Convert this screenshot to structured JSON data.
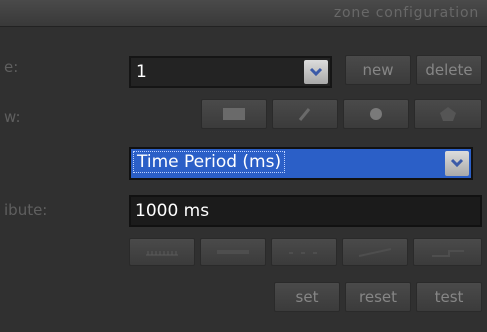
{
  "header": {
    "title": "zone configuration"
  },
  "rows": {
    "zone_label": "e:",
    "draw_label": "w:",
    "attribute_label": "ibute:"
  },
  "zone": {
    "selected": "1",
    "new_label": "new",
    "delete_label": "delete"
  },
  "draw_tools": [
    {
      "icon": "rectangle-icon"
    },
    {
      "icon": "pencil-icon"
    },
    {
      "icon": "circle-icon"
    },
    {
      "icon": "polygon-icon"
    }
  ],
  "property": {
    "selected": "Time Period (ms)"
  },
  "attribute": {
    "value": "1000 ms"
  },
  "shape_buttons": [
    {
      "icon": "ruler-icon"
    },
    {
      "icon": "line-icon"
    },
    {
      "icon": "dotted-line-icon"
    },
    {
      "icon": "ramp-icon"
    },
    {
      "icon": "step-icon"
    }
  ],
  "actions": {
    "set_label": "set",
    "reset_label": "reset",
    "test_label": "test"
  },
  "colors": {
    "background": "#303030",
    "selection": "#2b5fc7",
    "label": "#5f5f5f"
  }
}
